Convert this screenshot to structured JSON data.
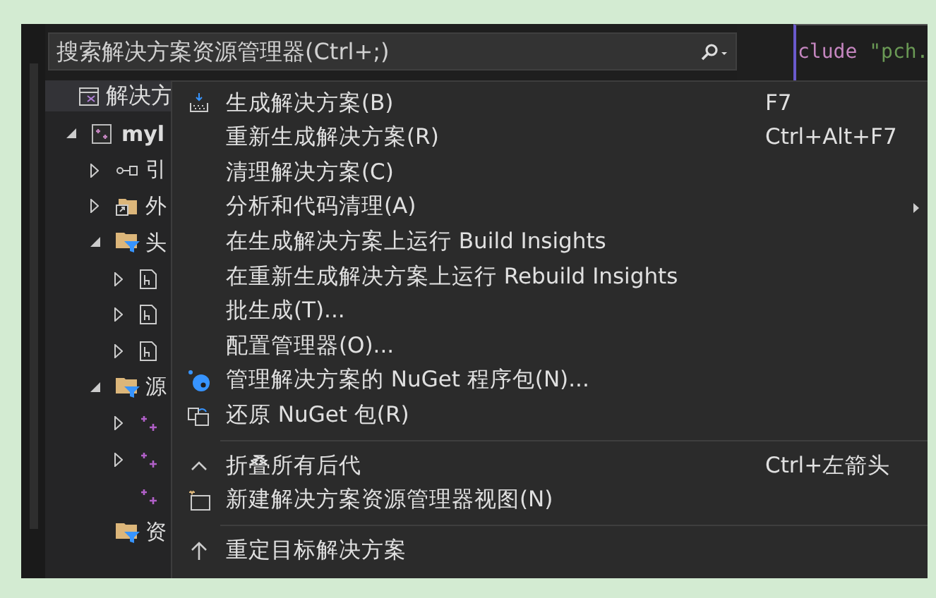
{
  "search": {
    "placeholder": "搜索解决方案资源管理器(Ctrl+;)"
  },
  "code": {
    "keyword": "clude",
    "string": "\"pch."
  },
  "explorer": {
    "header": "解决方",
    "tree": [
      {
        "label": "myl",
        "kind": "project",
        "expanded": true,
        "children": [
          {
            "label": "引",
            "kind": "references",
            "expanded": false
          },
          {
            "label": "外",
            "kind": "external",
            "expanded": false
          },
          {
            "label": "头",
            "kind": "filter",
            "expanded": true,
            "children": [
              {
                "kind": "header",
                "expanded": false
              },
              {
                "kind": "header",
                "expanded": false
              },
              {
                "kind": "header",
                "expanded": false
              }
            ]
          },
          {
            "label": "源",
            "kind": "filter",
            "expanded": true,
            "children": [
              {
                "kind": "source",
                "expanded": false
              },
              {
                "kind": "source",
                "expanded": false
              },
              {
                "kind": "source"
              }
            ]
          },
          {
            "label": "资",
            "kind": "filter"
          }
        ]
      }
    ]
  },
  "menu": [
    {
      "kind": "item",
      "label": "生成解决方案(B)",
      "shortcut": "F7"
    },
    {
      "kind": "item",
      "label": "重新生成解决方案(R)",
      "shortcut": "Ctrl+Alt+F7"
    },
    {
      "kind": "item",
      "label": "清理解决方案(C)"
    },
    {
      "kind": "item",
      "label": "分析和代码清理(A)",
      "submenu": true
    },
    {
      "kind": "item",
      "label": "在生成解决方案上运行 Build Insights"
    },
    {
      "kind": "item",
      "label": "在重新生成解决方案上运行 Rebuild Insights"
    },
    {
      "kind": "item",
      "label": "批生成(T)..."
    },
    {
      "kind": "item",
      "label": "配置管理器(O)..."
    },
    {
      "kind": "item",
      "label": "管理解决方案的 NuGet 程序包(N)..."
    },
    {
      "kind": "item",
      "label": "还原 NuGet 包(R)"
    },
    {
      "kind": "separator"
    },
    {
      "kind": "item",
      "label": "折叠所有后代",
      "shortcut": "Ctrl+左箭头"
    },
    {
      "kind": "item",
      "label": "新建解决方案资源管理器视图(N)"
    },
    {
      "kind": "separator"
    },
    {
      "kind": "item",
      "label": "重定目标解决方案"
    }
  ]
}
